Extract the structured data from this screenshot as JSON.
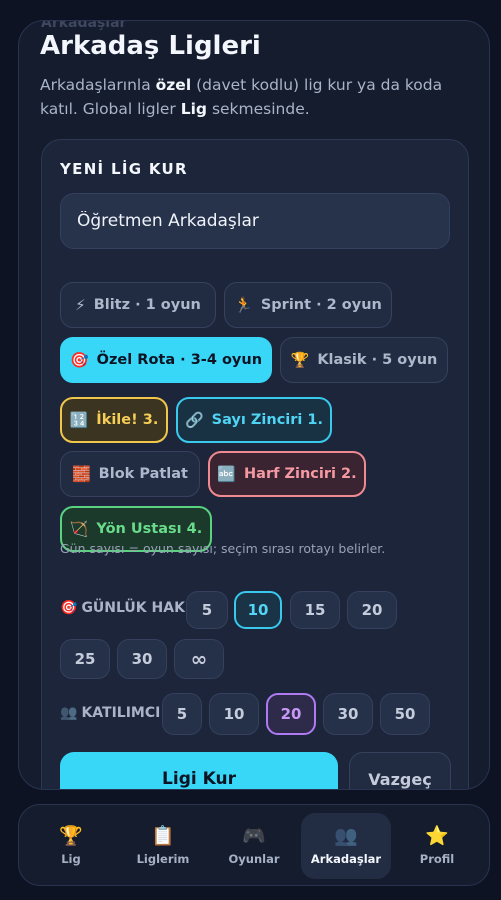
{
  "header": {
    "ghost_text": "Arkadaşlar",
    "title": "Arkadaş Ligleri",
    "desc_1": "Arkadaşlarınla ",
    "desc_bold_1": "özel",
    "desc_2": " (davet kodlu) lig kur ya da koda katıl. Global ligler ",
    "desc_bold_2": "Lig",
    "desc_3": " sekmesinde."
  },
  "form": {
    "title": "YENİ LİG KUR",
    "name_value": "Öğretmen Arkadaşlar",
    "modes": [
      {
        "icon": "⚡",
        "label": "Blitz · 1 oyun"
      },
      {
        "icon": "🏃",
        "label": "Sprint · 2 oyun"
      },
      {
        "icon": "🎯",
        "label": "Özel Rota · 3-4 oyun"
      },
      {
        "icon": "🏆",
        "label": "Klasik · 5 oyun"
      }
    ],
    "selected_mode": "Özel Rota · 3-4 oyun",
    "games": [
      {
        "icon": "🔢",
        "label": "İkile! 3.",
        "selected": true
      },
      {
        "icon": "🔗",
        "label": "Sayı Zinciri 1.",
        "selected": true
      },
      {
        "icon": "🧱",
        "label": "Blok Patlat",
        "selected": false
      },
      {
        "icon": "🔤",
        "label": "Harf Zinciri 2.",
        "selected": true
      },
      {
        "icon": "🏹",
        "label": "Yön Ustası 4.",
        "selected": true
      }
    ],
    "note": "Gün sayısı = oyun sayısı; seçim sırası rotayı belirler.",
    "daily_label": "GÜNLÜK HAK",
    "daily_icon": "🎯",
    "daily_options": [
      "5",
      "10",
      "15",
      "20",
      "25",
      "30",
      "∞"
    ],
    "daily_selected": "10",
    "participant_label": "KATILIMCI",
    "participant_icon": "👥",
    "participant_options": [
      "5",
      "10",
      "20",
      "30",
      "50"
    ],
    "participant_selected": "20",
    "submit_label": "Ligi Kur",
    "cancel_label": "Vazgeç"
  },
  "nav": {
    "items": [
      {
        "icon": "🏆",
        "label": "Lig"
      },
      {
        "icon": "📋",
        "label": "Liglerim"
      },
      {
        "icon": "🎮",
        "label": "Oyunlar"
      },
      {
        "icon": "👥",
        "label": "Arkadaşlar"
      },
      {
        "icon": "⭐",
        "label": "Profil"
      }
    ],
    "active": "Arkadaşlar"
  },
  "colors": {
    "accent_cyan": "#38d6f7",
    "yellow": "#f2c64a",
    "pink": "#ef8a93",
    "green": "#5ad27f",
    "purple": "#b07af2",
    "background": "#0d1322"
  }
}
